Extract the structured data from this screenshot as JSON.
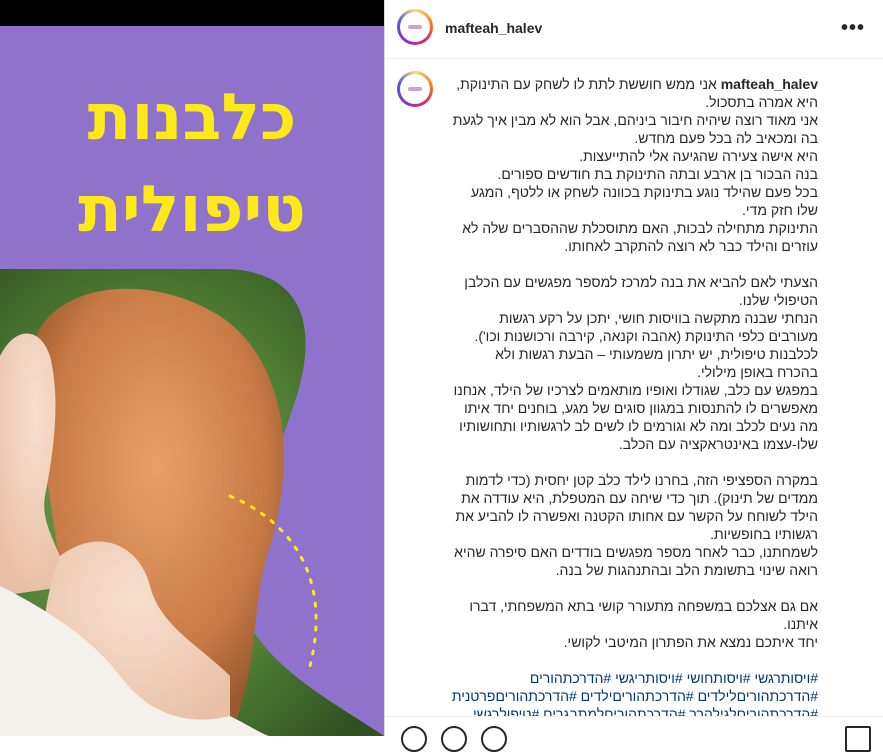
{
  "post": {
    "image": {
      "title_line1": "כלבנות",
      "title_line2": "טיפולית",
      "colors": {
        "background": "#8e72cc",
        "title": "#fde919",
        "accent_dots": "#fde919"
      }
    },
    "account": {
      "username": "mafteah_halev",
      "more_icon": "more-horizontal-icon"
    },
    "caption": {
      "username": "mafteah_halev",
      "paragraphs": [
        [
          "אני ממש חוששת לתת לו לשחק עם התינוקת, היא אמרה בתסכול.",
          "אני מאוד רוצה שיהיה חיבור ביניהם, אבל הוא לא מבין איך לגעת בה ומכאיב לה בכל פעם מחדש.",
          "היא אישה צעירה שהגיעה אלי להתייעצות.",
          "בנה הבכור בן ארבע ובתה התינוקת בת חודשים ספורים.",
          "בכל פעם שהילד נוגע בתינוקת בכוונה לשחק או ללטף, המגע שלו חזק מדי.",
          "התינוקת מתחילה לבכות, האם מתוסכלת שההסברים שלה לא עוזרים והילד כבר לא רוצה להתקרב לאחותו."
        ],
        [
          "הצעתי לאם להביא את בנה למרכז למספר מפגשים עם הכלבן הטיפולי שלנו.",
          "הנחתי שבנה מתקשה בוויסות חושי, יתכן על רקע רגשות מעורבים כלפי התינוקת (אהבה וקנאה, קירבה ורכושנות וכו').",
          "לכלבנות טיפולית, יש יתרון משמעותי – הבעת רגשות ולא בהכרח באופן מילולי.",
          "במפגש עם כלב, שגודלו ואופיו מותאמים לצרכיו של הילד, אנחנו מאפשרים לו להתנסות במגוון סוגים של מגע, בוחנים יחד איתו מה נעים לכלב ומה לא וגורמים לו לשים לב לרגשותיו ותחושותיו שלו-עצמו באינטראקציה עם הכלב."
        ],
        [
          "במקרה הספציפי הזה, בחרנו לילד כלב קטן יחסית (כדי לדמות ממדים של תינוק). תוך כדי שיחה עם המטפלת, היא עודדה את הילד לשוחח על הקשר עם אחותו הקטנה ואפשרה לו להביע את רגשותיו בחופשיות.",
          "לשמחתנו, כבר לאחר מספר מפגשים בודדים האם סיפרה שהיא רואה שינוי בתשומת הלב ובהתנהגות של בנה."
        ],
        [
          "אם גם אצלכם במשפחה מתעורר קושי בתא המשפחתי, דברו איתנו.",
          "יחד איתכם נמצא את הפתרון המיטבי לקושי."
        ]
      ],
      "hashtags": "#ויסותרגשי #ויסותחושי #ויסותריגשי #הדרכתהורים #הדרכתהוריםלילדים #הדרכתהוריםילדים #הדרכתהוריםפרטנית #הדרכתהוריםלגילהרך #הדרכתהוריםלמתבגרים #טיפולרגשי"
    }
  }
}
